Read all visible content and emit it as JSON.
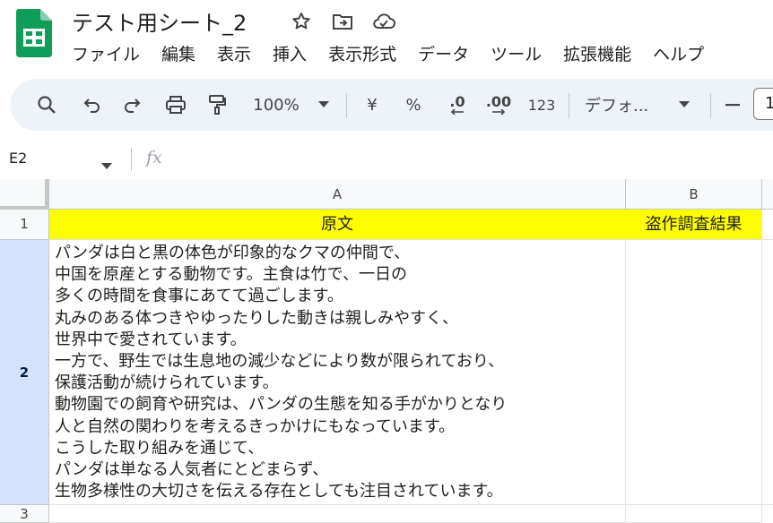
{
  "app": {
    "doc_title": "テスト用シート_2",
    "brand_color": "#0f9d58"
  },
  "menu": [
    "ファイル",
    "編集",
    "表示",
    "挿入",
    "表示形式",
    "データ",
    "ツール",
    "拡張機能",
    "ヘルプ"
  ],
  "toolbar": {
    "zoom": "100%",
    "currency": "¥",
    "percent": "%",
    "decimal_decrease": ".0",
    "decimal_increase": ".00",
    "number_format": "123",
    "font": "デフォ...",
    "font_size": "1"
  },
  "formula_bar": {
    "name_box": "E2",
    "fx": "fx"
  },
  "sheet": {
    "columns": [
      "A",
      "B"
    ],
    "rows": [
      "1",
      "2",
      "3"
    ],
    "header_fill": "#ffff00",
    "cells": {
      "A1": "原文",
      "B1": "盗作調査結果",
      "A2_lines": [
        "パンダは白と黒の体色が印象的なクマの仲間で、",
        "中国を原産とする動物です。主食は竹で、一日の",
        "多くの時間を食事にあてて過ごします。",
        "丸みのある体つきやゆったりした動きは親しみやすく、",
        "世界中で愛されています。",
        "一方で、野生では生息地の減少などにより数が限られており、",
        "保護活動が続けられています。",
        "動物園での飼育や研究は、パンダの生態を知る手がかりとなり",
        "人と自然の関わりを考えるきっかけにもなっています。",
        "こうした取り組みを通じて、",
        "パンダは単なる人気者にとどまらず、",
        "生物多様性の大切さを伝える存在としても注目されています。"
      ]
    }
  }
}
